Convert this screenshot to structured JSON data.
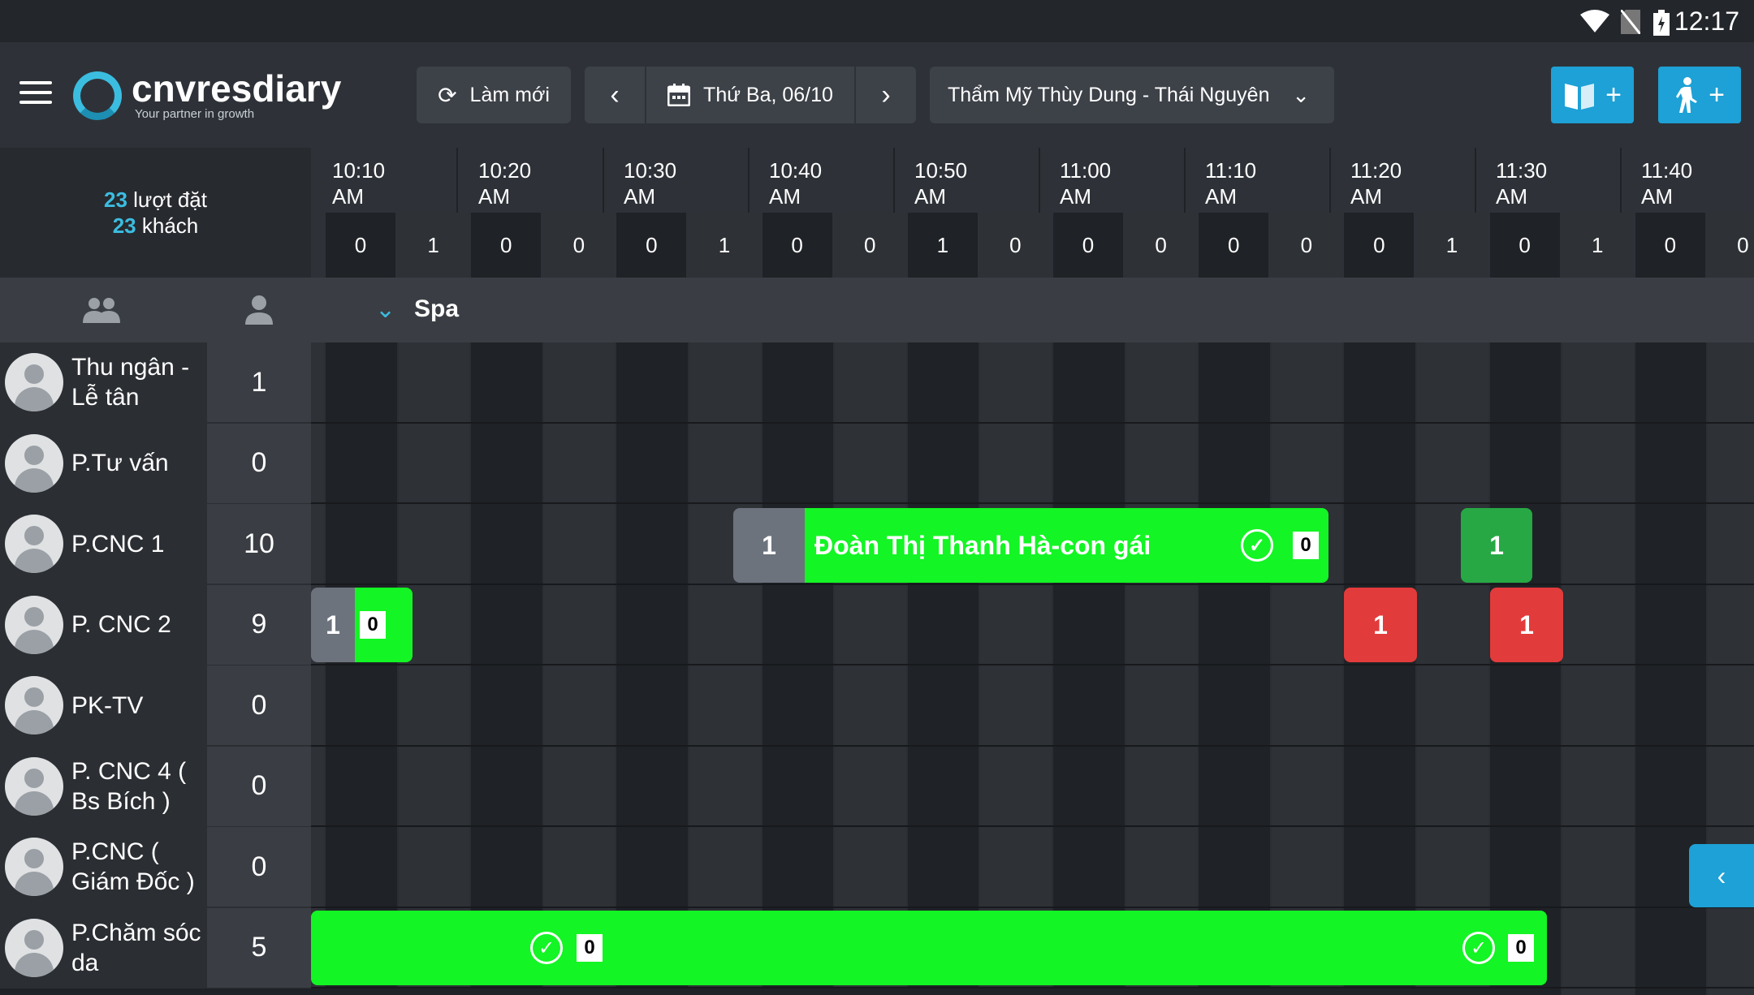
{
  "status": {
    "time": "12:17"
  },
  "app": {
    "logo_title": "cnvresdiary",
    "logo_subtitle": "Your partner in growth"
  },
  "toolbar": {
    "refresh_label": "Làm mới",
    "date_label": "Thứ Ba, 06/10",
    "branch_label": "Thẩm Mỹ Thùy Dung - Thái Nguyên",
    "add_book_label": "+",
    "add_walkin_label": "+"
  },
  "summary": {
    "bookings_count": "23",
    "bookings_label": "lượt đặt",
    "guests_count": "23",
    "guests_label": "khách"
  },
  "times": [
    [
      "10:10",
      "AM"
    ],
    [
      "10:20",
      "AM"
    ],
    [
      "10:30",
      "AM"
    ],
    [
      "10:40",
      "AM"
    ],
    [
      "10:50",
      "AM"
    ],
    [
      "11:00",
      "AM"
    ],
    [
      "11:10",
      "AM"
    ],
    [
      "11:20",
      "AM"
    ],
    [
      "11:30",
      "AM"
    ],
    [
      "11:40",
      "AM"
    ]
  ],
  "counts": [
    "0",
    "1",
    "0",
    "0",
    "0",
    "1",
    "0",
    "0",
    "1",
    "0",
    "0",
    "0",
    "0",
    "0",
    "0",
    "1",
    "0",
    "1",
    "0",
    "0"
  ],
  "group": {
    "name": "Spa"
  },
  "resources": [
    {
      "name": "Thu ngân - Lễ tân",
      "count": "1"
    },
    {
      "name": "P.Tư vấn",
      "count": "0"
    },
    {
      "name": "P.CNC 1",
      "count": "10"
    },
    {
      "name": "P. CNC 2",
      "count": "9"
    },
    {
      "name": "PK-TV",
      "count": "0"
    },
    {
      "name": "P. CNC 4 ( Bs Bích )",
      "count": "0"
    },
    {
      "name": "P.CNC ( Giám Đốc )",
      "count": "0"
    },
    {
      "name": "P.Chăm sóc da",
      "count": "5"
    }
  ],
  "bookings": {
    "cnc1_main": {
      "num": "1",
      "name": "Đoàn Thị Thanh Hà-con gái",
      "zero": "0"
    },
    "cnc1_tile": "1",
    "cnc2_small": {
      "num": "1",
      "zero": "0"
    },
    "cnc2_red1": "1",
    "cnc2_red2": "1",
    "cham_soc": {
      "zero1": "0",
      "zero2": "0"
    }
  },
  "colors": {
    "accent": "#1da1d6",
    "green": "#13f524",
    "dark_green": "#27a845",
    "red": "#e23b3b"
  }
}
